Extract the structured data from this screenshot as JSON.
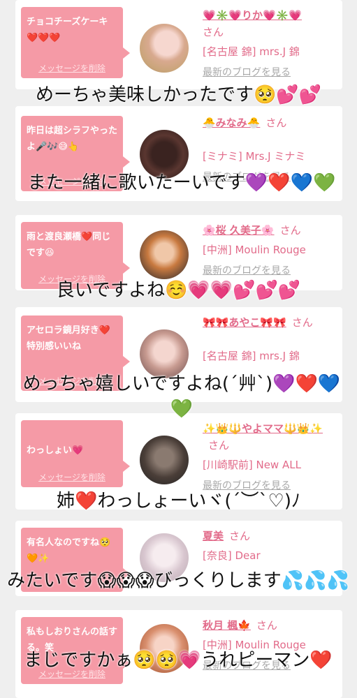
{
  "delete_label": "メッセージを削除",
  "blog_label": "最新のブログを見る",
  "san_label": "さん",
  "cards": [
    {
      "message": "チョコチーズケーキ❤️❤️❤️",
      "name": "💗✳️💗りか💗✳️💗",
      "shop": "[名古屋 錦] mrs.J 錦",
      "caption": "めーちゃ美味しかったです🥺💕💕"
    },
    {
      "message": "昨日は超シラフやったよ🎤🎶😅👆",
      "name": "🐣みなみ🐣",
      "shop": "[ミナミ] Mrs.J ミナミ",
      "caption": "また一緒に歌いたーいです💜❤️💙💚"
    },
    {
      "message": "雨と渡良瀬橋❤️同じです😆",
      "name": "🌸桜 久美子🌸",
      "shop": "[中洲] Moulin Rouge",
      "caption": "良いですよね☺️💗💗💕💕💕"
    },
    {
      "message": "アセロラ鏡月好き❤️特別感いいね",
      "name": "🎀🎀あやこ🎀🎀",
      "shop": "[名古屋 錦] mrs.J 錦",
      "caption": "めっちゃ嬉しいですよね(´艸`)💜❤️💙💚"
    },
    {
      "message": "わっしょい💗",
      "name": "✨👑🔱やよママ🔱👑✨",
      "shop": "[川崎駅前] New ALL",
      "caption": "姉❤️わっしょーいヾ(´︶`♡)ﾉ"
    },
    {
      "message": "有名人なのですね🥺🧡✨",
      "name": "夏美",
      "shop": "[奈良] Dear",
      "caption": "みたいです😱😱😱びっくりします💦💦💦"
    },
    {
      "message": "私もしおりさんの話する。笑",
      "name": "秋月 楓🍁",
      "shop": "[中洲] Moulin Rouge",
      "caption": "まじですかぁ🥺🥺💗うれピーマン❤️"
    }
  ]
}
